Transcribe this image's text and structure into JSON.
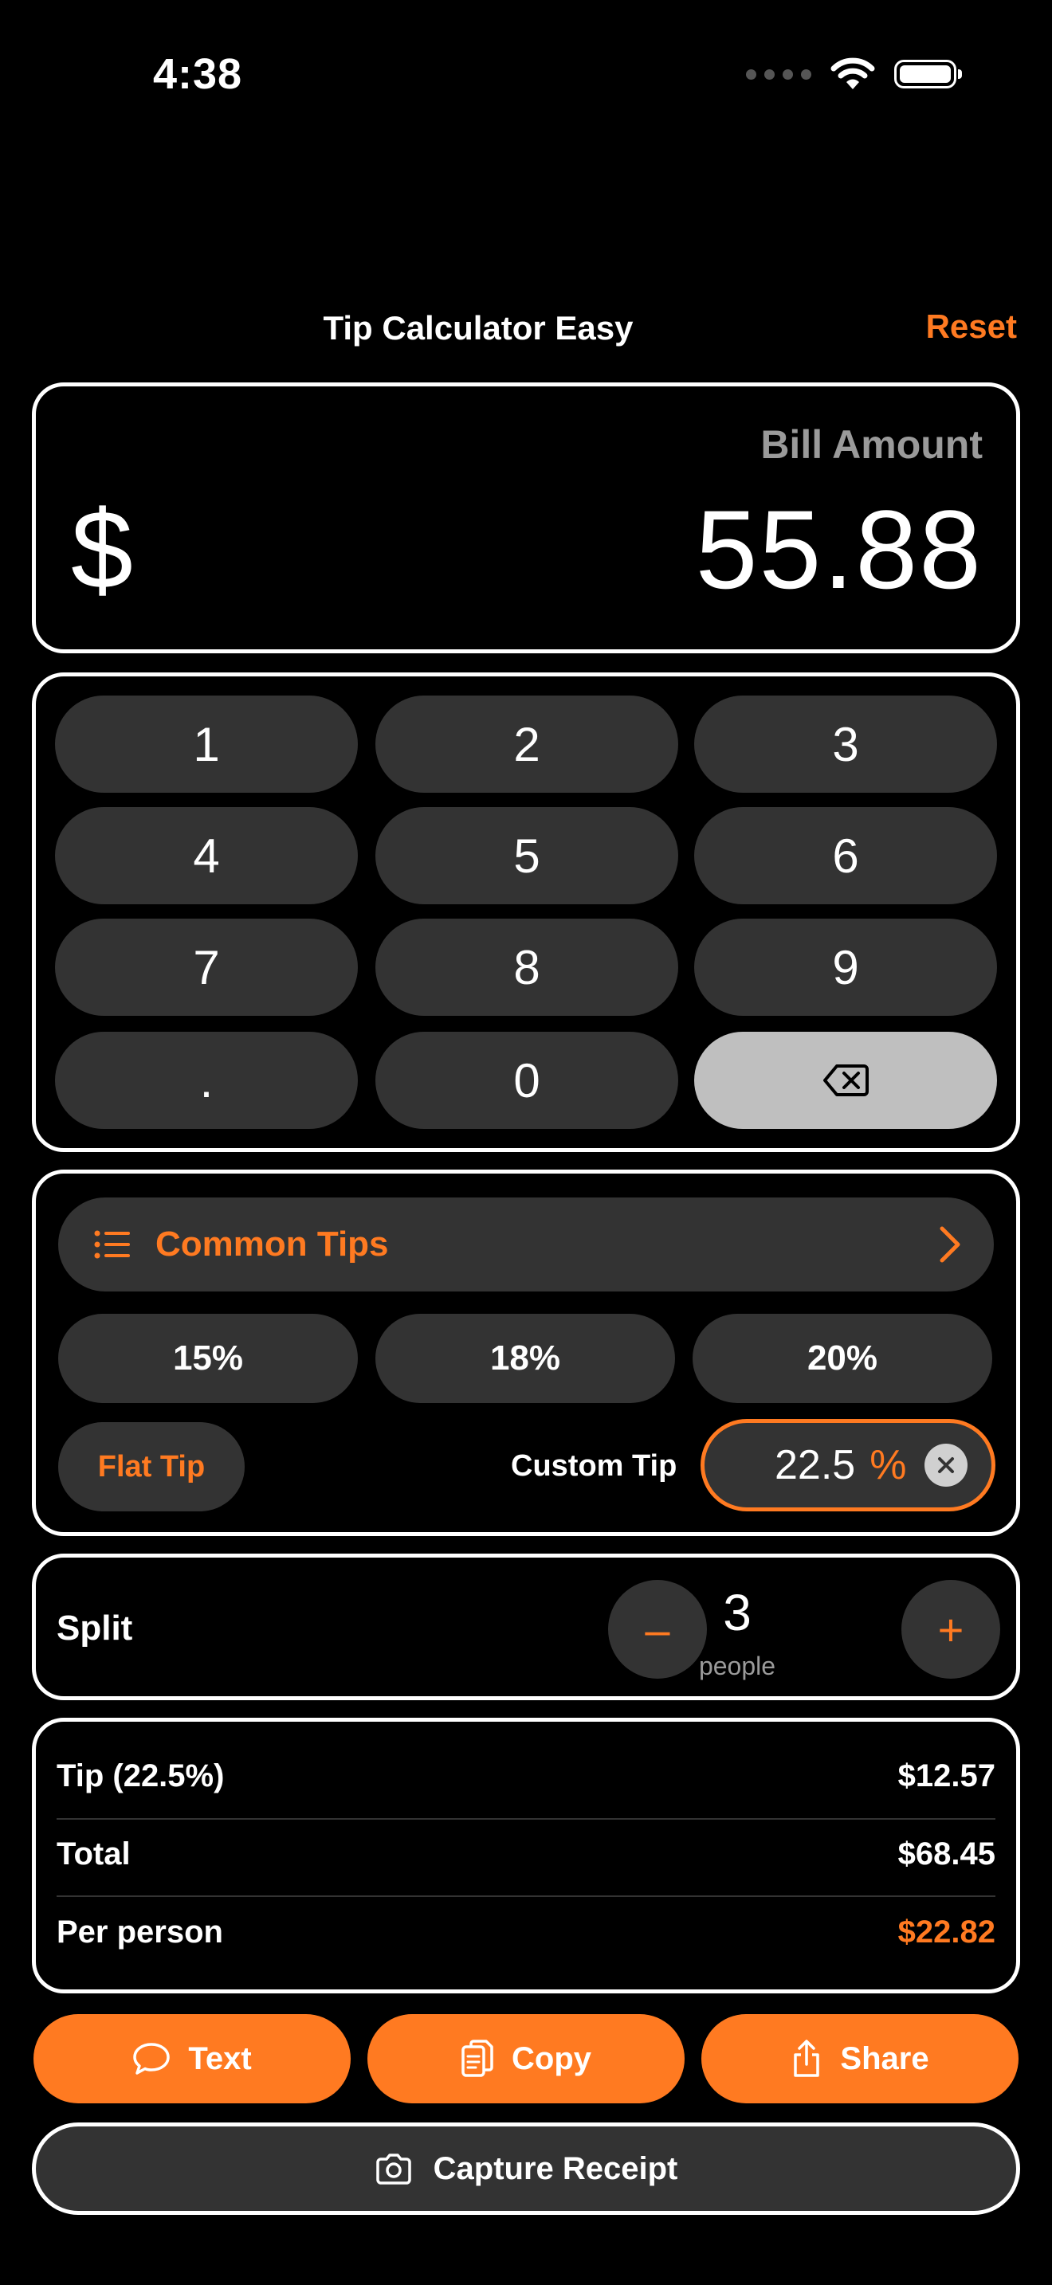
{
  "status_bar": {
    "time": "4:38"
  },
  "header": {
    "title": "Tip Calculator Easy",
    "reset_label": "Reset"
  },
  "bill": {
    "label": "Bill Amount",
    "currency": "$",
    "value": "55.88"
  },
  "keypad": {
    "keys": [
      "1",
      "2",
      "3",
      "4",
      "5",
      "6",
      "7",
      "8",
      "9",
      ".",
      "0"
    ],
    "backspace_icon": "delete-left-icon"
  },
  "tips": {
    "common_label": "Common Tips",
    "presets": [
      "15%",
      "18%",
      "20%"
    ],
    "flat_label": "Flat Tip",
    "custom_label": "Custom Tip",
    "custom_value": "22.5",
    "custom_unit": "%"
  },
  "split": {
    "label": "Split",
    "minus": "–",
    "plus": "+",
    "count": "3",
    "unit": "people"
  },
  "summary": {
    "rows": [
      {
        "label": "Tip (22.5%)",
        "value": "$12.57"
      },
      {
        "label": "Total",
        "value": "$68.45"
      },
      {
        "label": "Per person",
        "value": "$22.82"
      }
    ]
  },
  "actions": {
    "text": "Text",
    "copy": "Copy",
    "share": "Share",
    "capture": "Capture Receipt"
  },
  "colors": {
    "accent": "#ff7a21",
    "button": "#333333",
    "background": "#000000"
  }
}
